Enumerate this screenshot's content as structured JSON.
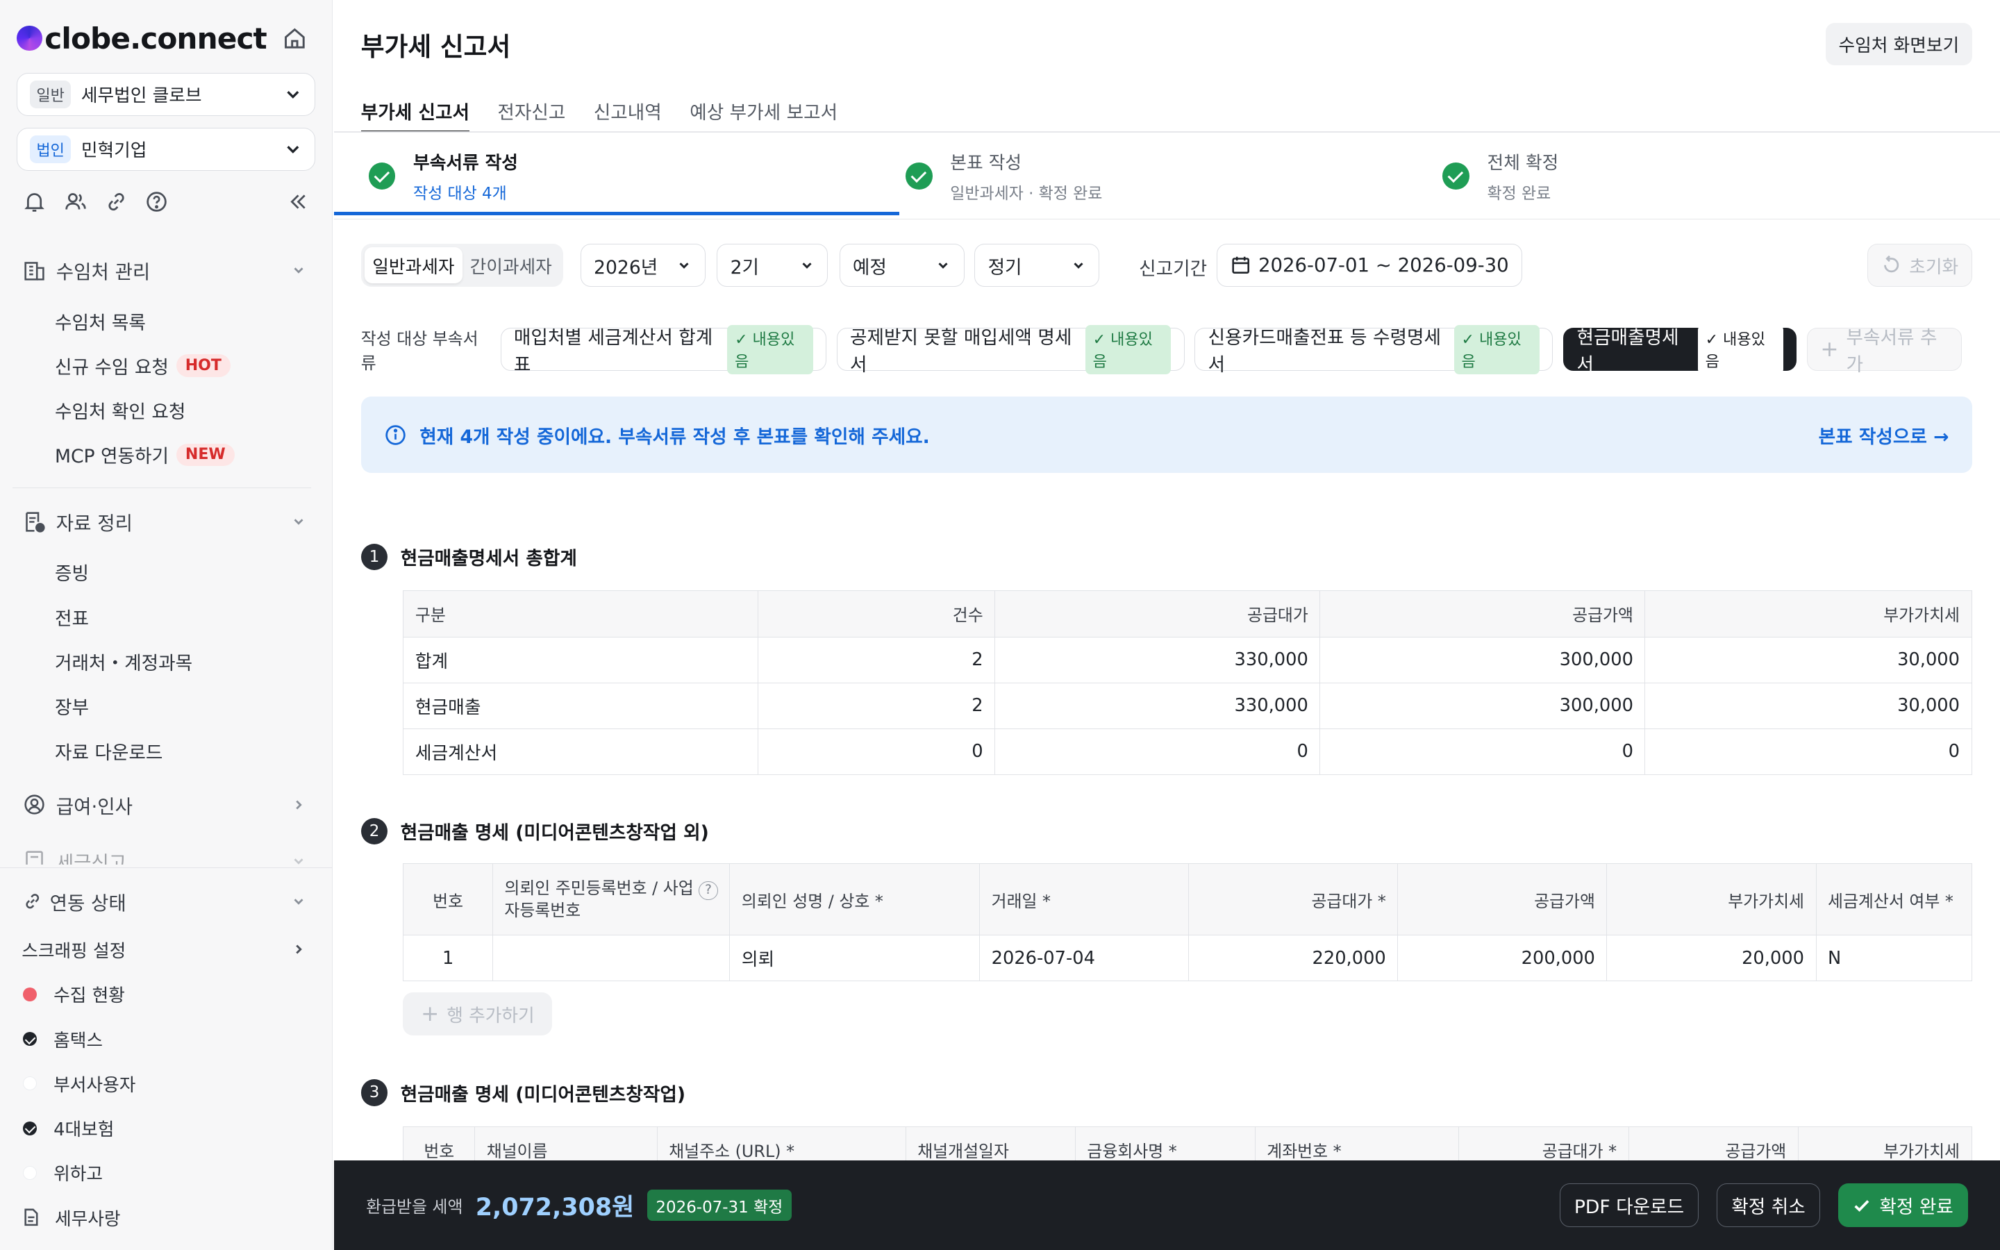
{
  "app": {
    "logo": "clobe.connect"
  },
  "sidebar": {
    "org_tag": "일반",
    "org_name": "세무법인 클로브",
    "client_tag": "법인",
    "client_name": "민혁기업",
    "sections": [
      {
        "label": "수임처 관리",
        "items": [
          "수임처 목록",
          "신규 수임 요청",
          "수임처 확인 요청",
          "MCP 연동하기"
        ]
      },
      {
        "label": "자료 정리",
        "items": [
          "증빙",
          "전표",
          "거래처・계정과목",
          "장부",
          "자료 다운로드"
        ]
      },
      {
        "label": "급여·인사"
      },
      {
        "label": "세금신고"
      }
    ],
    "badge_hot": "HOT",
    "badge_new": "NEW",
    "sync": {
      "title": "연동 상태",
      "scraping": "스크래핑 설정",
      "items": [
        "수집 현황",
        "홈택스",
        "부서사용자",
        "4대보험",
        "위하고",
        "세무사랑"
      ]
    }
  },
  "header": {
    "title": "부가세 신고서",
    "view_client_button": "수임처 화면보기",
    "tabs": [
      "부가세 신고서",
      "전자신고",
      "신고내역",
      "예상 부가세 보고서"
    ]
  },
  "steps": [
    {
      "title": "부속서류 작성",
      "sub": "작성 대상 4개"
    },
    {
      "title": "본표 작성",
      "sub": "일반과세자 · 확정 완료"
    },
    {
      "title": "전체 확정",
      "sub": "확정 완료"
    }
  ],
  "filters": {
    "taxpayer_types": [
      "일반과세자",
      "간이과세자"
    ],
    "year": "2026년",
    "term": "2기",
    "type": "예정",
    "kind": "정기",
    "period_label": "신고기간",
    "period": "2026-07-01 ~ 2026-09-30",
    "reset": "초기화"
  },
  "docs": {
    "label": "작성 대상 부속서류",
    "items": [
      {
        "name": "매입처별 세금계산서 합계표",
        "status": "내용있음"
      },
      {
        "name": "공제받지 못할 매입세액 명세서",
        "status": "내용있음"
      },
      {
        "name": "신용카드매출전표 등 수령명세서",
        "status": "내용있음"
      },
      {
        "name": "현금매출명세서",
        "status": "내용있음"
      }
    ],
    "add": "부속서류 추가"
  },
  "info": {
    "text": "현재 4개 작성 중이에요. 부속서류 작성 후 본표를 확인해 주세요.",
    "link": "본표 작성으로 →"
  },
  "section1": {
    "num": "1",
    "title": "현금매출명세서 총합계",
    "headers": [
      "구분",
      "건수",
      "공급대가",
      "공급가액",
      "부가가치세"
    ],
    "rows": [
      [
        "합계",
        "2",
        "330,000",
        "300,000",
        "30,000"
      ],
      [
        "현금매출",
        "2",
        "330,000",
        "300,000",
        "30,000"
      ],
      [
        "세금계산서",
        "0",
        "0",
        "0",
        "0"
      ]
    ]
  },
  "section2": {
    "num": "2",
    "title": "현금매출 명세 (미디어콘텐츠창작업 외)",
    "headers": [
      "번호",
      "의뢰인 주민등록번호 / 사업자등록번호",
      "의뢰인 성명 / 상호 *",
      "거래일 *",
      "공급대가 *",
      "공급가액",
      "부가가치세",
      "세금계산서 여부 *"
    ],
    "help": "?",
    "rows": [
      [
        "1",
        "",
        "의뢰",
        "2026-07-04",
        "220,000",
        "200,000",
        "20,000",
        "N"
      ]
    ],
    "add_row": "행 추가하기"
  },
  "section3": {
    "num": "3",
    "title": "현금매출 명세 (미디어콘텐츠창작업)",
    "headers": [
      "번호",
      "채널이름",
      "채널주소 (URL) *",
      "채널개설일자",
      "금융회사명 *",
      "계좌번호 *",
      "공급대가 *",
      "공급가액",
      "부가가치세"
    ]
  },
  "footer": {
    "refund_label": "환급받을 세액",
    "refund_amount": "2,072,308원",
    "confirm_badge": "2026-07-31 확정",
    "pdf": "PDF 다운로드",
    "cancel": "확정 취소",
    "complete": "확정 완료"
  },
  "colors": {
    "accent": "#1467d8",
    "success": "#1f9d55",
    "dark": "#1c1f24"
  }
}
